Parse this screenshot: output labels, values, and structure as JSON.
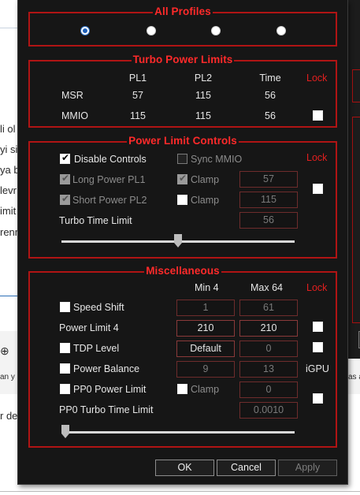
{
  "background": {
    "lines": [
      "li ol",
      "yi si",
      "ya b",
      "levr",
      "imit",
      "renn"
    ],
    "circle_up_icon": "circle-arrow-up-icon",
    "text_an_y": "an y",
    "text_r_de": "r de",
    "text_right_as": "as a"
  },
  "all_profiles": {
    "title": "All Profiles",
    "selected_index": 0
  },
  "turbo": {
    "title": "Turbo Power Limits",
    "headers": {
      "pl1": "PL1",
      "pl2": "PL2",
      "time": "Time",
      "lock": "Lock"
    },
    "rows": [
      {
        "name": "MSR",
        "pl1": "57",
        "pl2": "115",
        "time": "56"
      },
      {
        "name": "MMIO",
        "pl1": "115",
        "pl2": "115",
        "time": "56"
      }
    ]
  },
  "plc": {
    "title": "Power Limit Controls",
    "disable_controls": "Disable Controls",
    "sync_mmio": "Sync MMIO",
    "lock": "Lock",
    "long_power": "Long Power PL1",
    "short_power": "Short Power PL2",
    "clamp": "Clamp",
    "long_value": "57",
    "short_value": "115",
    "turbo_time_label": "Turbo Time Limit",
    "turbo_time_value": "56",
    "slider_level": 0.5
  },
  "misc": {
    "title": "Miscellaneous",
    "min_label": "Min  4",
    "max_label": "Max  64",
    "lock": "Lock",
    "speed_shift": {
      "label": "Speed Shift",
      "min": "1",
      "max": "61"
    },
    "power_limit4": {
      "label": "Power Limit 4",
      "a": "210",
      "b": "210"
    },
    "tdp_level": {
      "label": "TDP Level",
      "a": "Default",
      "b": "0"
    },
    "power_balance": {
      "label": "Power Balance",
      "a": "9",
      "b": "13",
      "extra": "iGPU"
    },
    "pp0_power_limit": {
      "label": "PP0 Power Limit",
      "clamp": "Clamp",
      "value": "0"
    },
    "pp0_turbo_time": {
      "label": "PP0 Turbo Time Limit",
      "value": "0.0010"
    },
    "slider_level": 0.0
  },
  "buttons": {
    "ok": "OK",
    "cancel": "Cancel",
    "apply": "Apply"
  },
  "colors": {
    "accent_red": "#b01414",
    "title_red": "#ff2a2a",
    "dialog_bg": "#161616"
  }
}
